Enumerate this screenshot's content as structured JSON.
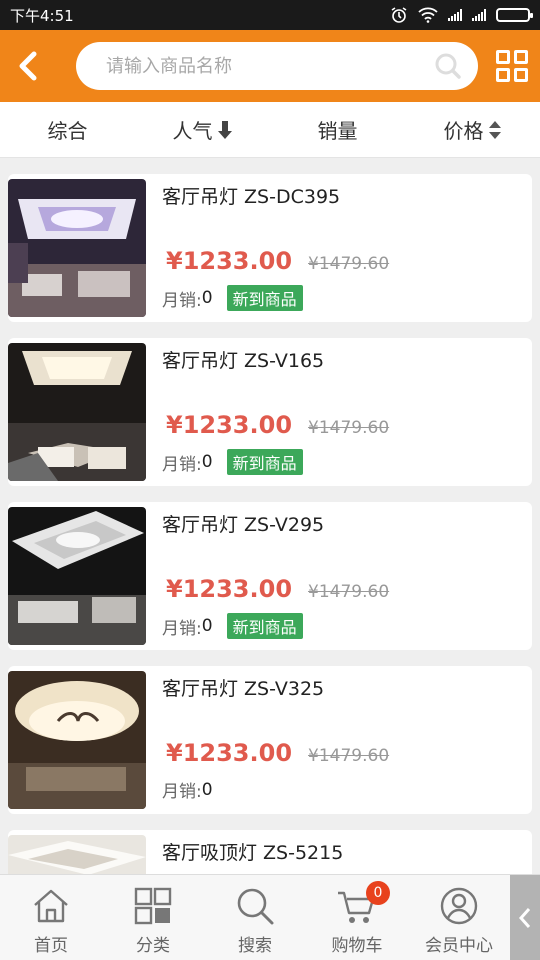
{
  "status_bar": {
    "time": "下午4:51"
  },
  "header": {
    "search_placeholder": "请输入商品名称"
  },
  "sort_tabs": [
    {
      "label": "综合"
    },
    {
      "label": "人气"
    },
    {
      "label": "销量"
    },
    {
      "label": "价格"
    }
  ],
  "products": [
    {
      "title": "客厅吊灯 ZS-DC395",
      "price": "¥1233.00",
      "old_price": "¥1479.60",
      "sales_label": "月销:",
      "sales": "0",
      "tag": "新到商品"
    },
    {
      "title": "客厅吊灯 ZS-V165",
      "price": "¥1233.00",
      "old_price": "¥1479.60",
      "sales_label": "月销:",
      "sales": "0",
      "tag": "新到商品"
    },
    {
      "title": "客厅吊灯 ZS-V295",
      "price": "¥1233.00",
      "old_price": "¥1479.60",
      "sales_label": "月销:",
      "sales": "0",
      "tag": "新到商品"
    },
    {
      "title": "客厅吊灯 ZS-V325",
      "price": "¥1233.00",
      "old_price": "¥1479.60",
      "sales_label": "月销:",
      "sales": "0"
    },
    {
      "title": "客厅吸顶灯 ZS-5215"
    }
  ],
  "tabbar": [
    {
      "label": "首页",
      "icon": "home-icon"
    },
    {
      "label": "分类",
      "icon": "category-icon"
    },
    {
      "label": "搜索",
      "icon": "search-icon"
    },
    {
      "label": "购物车",
      "icon": "cart-icon",
      "badge": "0"
    },
    {
      "label": "会员中心",
      "icon": "user-icon"
    }
  ],
  "colors": {
    "brand": "#f08519",
    "price": "#e05a4d",
    "tag": "#3ca85a",
    "badge": "#e8421d"
  }
}
